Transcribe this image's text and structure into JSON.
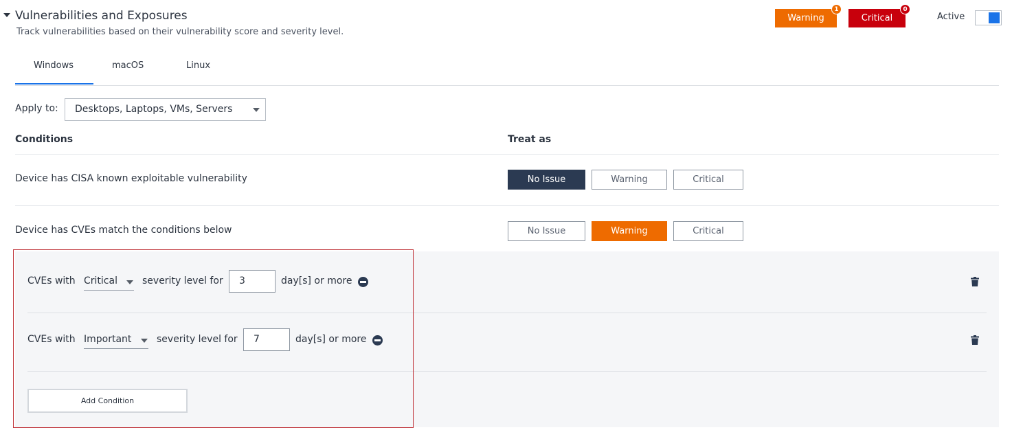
{
  "header": {
    "title": "Vulnerabilities and Exposures",
    "subtitle": "Track vulnerabilities based on their vulnerability score and severity level.",
    "warning_label": "Warning",
    "warning_count": "1",
    "critical_label": "Critical",
    "critical_count": "0",
    "active_label": "Active",
    "active_on": true
  },
  "tabs": [
    {
      "label": "Windows",
      "selected": true
    },
    {
      "label": "macOS",
      "selected": false
    },
    {
      "label": "Linux",
      "selected": false
    }
  ],
  "apply_to": {
    "label": "Apply to:",
    "value": "Desktops, Laptops, VMs, Servers"
  },
  "columns": {
    "conditions": "Conditions",
    "treat_as": "Treat as"
  },
  "conditions": [
    {
      "text": "Device has CISA known exploitable vulnerability",
      "options": [
        "No Issue",
        "Warning",
        "Critical"
      ],
      "selected": "No Issue"
    },
    {
      "text": "Device has CVEs match the conditions below",
      "options": [
        "No Issue",
        "Warning",
        "Critical"
      ],
      "selected": "Warning"
    }
  ],
  "rules": [
    {
      "prefix": "CVEs with",
      "severity": "Critical",
      "middle": "severity level for",
      "days": "3",
      "suffix": "day[s] or more"
    },
    {
      "prefix": "CVEs with",
      "severity": "Important",
      "middle": "severity level for",
      "days": "7",
      "suffix": "day[s] or more"
    }
  ],
  "add_condition_label": "Add Condition",
  "colors": {
    "accent": "#1a73e8",
    "warning": "#ee6b00",
    "critical": "#c8000c",
    "selected_dark": "#2b3a52",
    "highlight_border": "#c0343a"
  }
}
